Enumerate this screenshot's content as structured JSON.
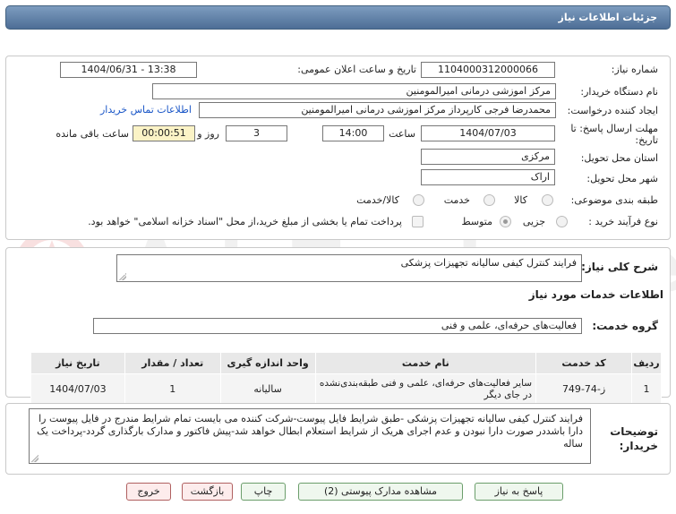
{
  "header": {
    "title": "جزئیات اطلاعات نیاز"
  },
  "fields": {
    "need_number_label": "شماره نیاز:",
    "need_number": "1104000312000066",
    "announce_label": "تاریخ و ساعت اعلان عمومی:",
    "announce_value": "1404/06/31 - 13:38",
    "buyer_label": "نام دستگاه خریدار:",
    "buyer_value": "مرکز اموزشی درمانی امیرالمومنین",
    "creator_label": "ایجاد کننده درخواست:",
    "creator_value": "محمدرضا فرجی کارپرداز مرکز اموزشی درمانی امیرالمومنین",
    "contact_link": "اطلاعات تماس خریدار",
    "deadline_label": "مهلت ارسال پاسخ: تا تاریخ:",
    "deadline_date": "1404/07/03",
    "time_label": "ساعت",
    "deadline_time": "14:00",
    "days_value": "3",
    "days_label": "روز و",
    "remaining_value": "00:00:51",
    "remaining_label": "ساعت باقی مانده",
    "province_label": "استان محل تحویل:",
    "province_value": "مرکزی",
    "city_label": "شهر محل تحویل:",
    "city_value": "اراک",
    "category_label": "طبقه بندی موضوعی:",
    "category_options": [
      "کالا",
      "خدمت",
      "کالا/خدمت"
    ],
    "process_label": "نوع فرآیند خرید :",
    "process_options": [
      "جزیی",
      "متوسط"
    ],
    "payment_note": "پرداخت تمام یا بخشی از مبلغ خرید،از محل \"اسناد خزانه اسلامی\" خواهد بود."
  },
  "summary": {
    "label": "شرح کلی نیاز:",
    "value": "فرایند کنترل کیفی سالیانه تجهیزات پزشکی"
  },
  "services": {
    "section_title": "اطلاعات خدمات مورد نیاز",
    "group_label": "گروه خدمت:",
    "group_value": "فعالیت‌های حرفه‌ای، علمی و فنی"
  },
  "table": {
    "headers": [
      "ردیف",
      "کد خدمت",
      "نام خدمت",
      "واحد اندازه گیری",
      "تعداد / مقدار",
      "تاریخ نیاز"
    ],
    "rows": [
      [
        "1",
        "ز-74-749",
        "سایر فعالیت‌های حرفه‌ای، علمی و فنی طبقه‌بندی‌نشده در جای دیگر",
        "سالیانه",
        "1",
        "1404/07/03"
      ]
    ]
  },
  "buyer_notes": {
    "label": "توضیحات خریدار:",
    "value": "فرایند کنترل کیفی سالیانه تجهیزات پزشکی -طبق شرایط فایل پیوست-شرکت کننده می بایست تمام شرایط مندرج در فایل پیوست را دارا باشددر صورت دارا نبودن و عدم اجرای هریک از شرایط استعلام ابطال خواهد شد-پیش فاکتور و مدارک بارگذاری گردد-پرداخت یک ساله"
  },
  "buttons": {
    "reply": "پاسخ به نیاز",
    "view_docs": "مشاهده مدارک پیوستی (2)",
    "print": "چاپ",
    "back": "بازگشت",
    "exit": "خروج"
  },
  "watermark": {
    "text": "AriaTender.neT"
  },
  "colors": {
    "header_bg": "#5b7ca3",
    "link": "#1a56c7",
    "remaining_bg": "#fbf3c6",
    "button_border": "#6b9e6b",
    "danger_border": "#b06060"
  }
}
